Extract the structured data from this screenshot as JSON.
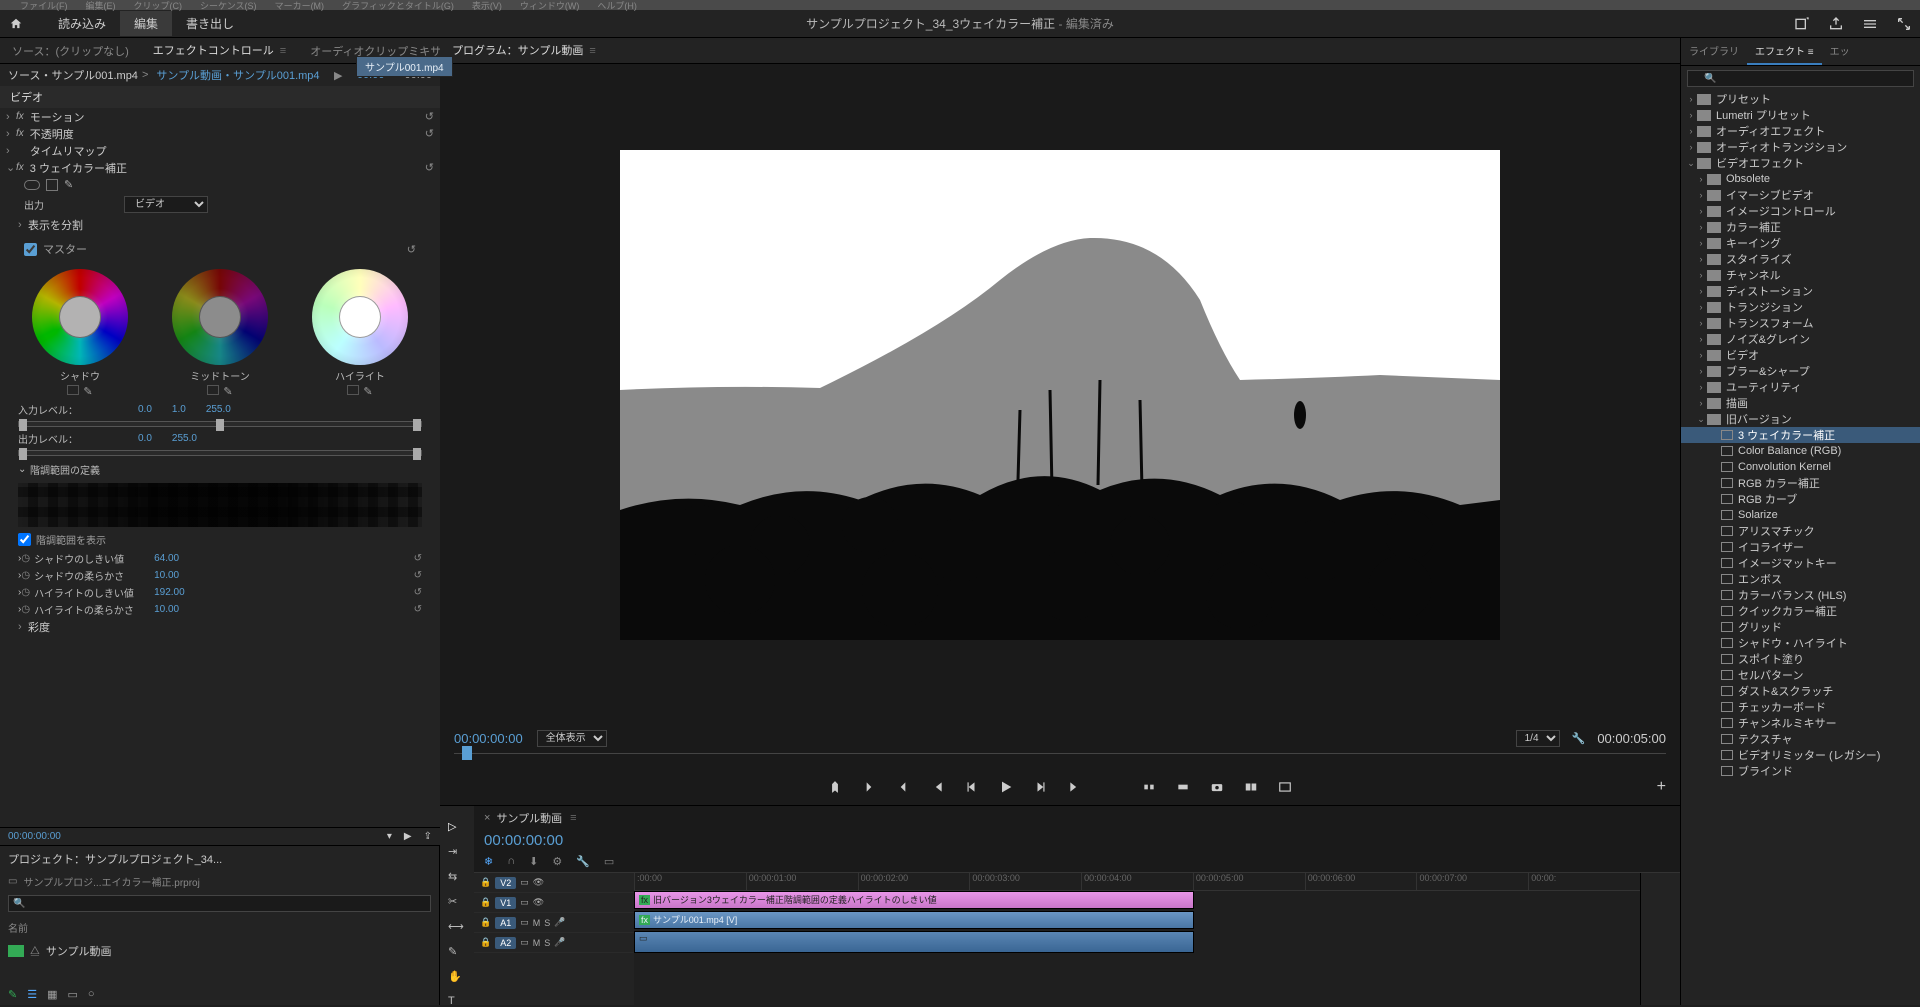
{
  "titlebar_menus": [
    "ファイル(F)",
    "編集(E)",
    "クリップ(C)",
    "シーケンス(S)",
    "マーカー(M)",
    "グラフィックとタイトル(G)",
    "表示(V)",
    "ウィンドウ(W)",
    "ヘルプ(H)"
  ],
  "workspace_tabs": {
    "import": "読み込み",
    "edit": "編集",
    "export": "書き出し"
  },
  "project_title": "サンプルプロジェクト_34_3ウェイカラー補正",
  "project_unsaved": " - 編集済み",
  "source_tabs": {
    "source": "ソース：(クリップなし)",
    "effect": "エフェクトコントロール",
    "audio_mixer": "オーディオクリップミキサー：サンプル動画"
  },
  "source_line": {
    "src": "ソース・サンプル001.mp4",
    "link": "サンプル動画・サンプル001.mp4",
    "tc1": "00:00",
    "tc2": "00:00"
  },
  "source_clip_tab": "サンプル001.mp4",
  "effect_section": "ビデオ",
  "fx": {
    "motion": "モーション",
    "opacity": "不透明度",
    "timeremap": "タイムリマップ",
    "threeway": "3 ウェイカラー補正"
  },
  "threeway": {
    "output_label": "出力",
    "output_value": "ビデオ",
    "split_label": "表示を分割",
    "master": "マスター",
    "wheels": {
      "shadow": "シャドウ",
      "midtone": "ミッドトーン",
      "highlight": "ハイライト"
    },
    "in_level": "入力レベル：",
    "in_vals": [
      "0.0",
      "1.0",
      "255.0"
    ],
    "out_level": "出力レベル：",
    "out_vals": [
      "0.0",
      "255.0"
    ],
    "tonal_def": "階調範囲の定義",
    "show_tonal": "階調範囲を表示",
    "params": [
      {
        "name": "シャドウのしきい値",
        "v": "64.00"
      },
      {
        "name": "シャドウの柔らかさ",
        "v": "10.00"
      },
      {
        "name": "ハイライトのしきい値",
        "v": "192.00"
      },
      {
        "name": "ハイライトの柔らかさ",
        "v": "10.00"
      }
    ],
    "sat": "彩度"
  },
  "effect_tc": "00:00:00:00",
  "program": {
    "tab": "プログラム：サンプル動画",
    "tc_in": "00:00:00:00",
    "fit": "全体表示",
    "scale": "1/4",
    "tc_out": "00:00:05:00"
  },
  "project_panel": {
    "title": "プロジェクト：サンプルプロジェクト_34...",
    "sub": "サンプルプロジ...エイカラー補正.prproj",
    "col": "名前",
    "item": "サンプル動画"
  },
  "timeline": {
    "seq": "サンプル動画",
    "tc": "00:00:00:00",
    "ruler": [
      ":00:00",
      "00:00:01:00",
      "00:00:02:00",
      "00:00:03:00",
      "00:00:04:00",
      "00:00:05:00",
      "00:00:06:00",
      "00:00:07:00",
      "00:00:"
    ],
    "tracks": {
      "v2": "V2",
      "v1": "V1",
      "a1": "A1",
      "a2": "A2"
    },
    "clip_fx": "旧バージョン3ウェイカラー補正階調範囲の定義ハイライトのしきい値",
    "clip_vid": "サンプル001.mp4 [V]"
  },
  "effects_panel": {
    "tabs": {
      "library": "ライブラリ",
      "effects": "エフェクト",
      "ess": "エッ"
    },
    "tree": [
      {
        "d": 0,
        "t": "folder",
        "open": false,
        "label": "プリセット"
      },
      {
        "d": 0,
        "t": "folder",
        "open": false,
        "label": "Lumetri プリセット"
      },
      {
        "d": 0,
        "t": "folder",
        "open": false,
        "label": "オーディオエフェクト"
      },
      {
        "d": 0,
        "t": "folder",
        "open": false,
        "label": "オーディオトランジション"
      },
      {
        "d": 0,
        "t": "folder",
        "open": true,
        "label": "ビデオエフェクト"
      },
      {
        "d": 1,
        "t": "folder",
        "open": false,
        "label": "Obsolete"
      },
      {
        "d": 1,
        "t": "folder",
        "open": false,
        "label": "イマーシブビデオ"
      },
      {
        "d": 1,
        "t": "folder",
        "open": false,
        "label": "イメージコントロール"
      },
      {
        "d": 1,
        "t": "folder",
        "open": false,
        "label": "カラー補正"
      },
      {
        "d": 1,
        "t": "folder",
        "open": false,
        "label": "キーイング"
      },
      {
        "d": 1,
        "t": "folder",
        "open": false,
        "label": "スタイライズ"
      },
      {
        "d": 1,
        "t": "folder",
        "open": false,
        "label": "チャンネル"
      },
      {
        "d": 1,
        "t": "folder",
        "open": false,
        "label": "ディストーション"
      },
      {
        "d": 1,
        "t": "folder",
        "open": false,
        "label": "トランジション"
      },
      {
        "d": 1,
        "t": "folder",
        "open": false,
        "label": "トランスフォーム"
      },
      {
        "d": 1,
        "t": "folder",
        "open": false,
        "label": "ノイズ&グレイン"
      },
      {
        "d": 1,
        "t": "folder",
        "open": false,
        "label": "ビデオ"
      },
      {
        "d": 1,
        "t": "folder",
        "open": false,
        "label": "ブラー&シャープ"
      },
      {
        "d": 1,
        "t": "folder",
        "open": false,
        "label": "ユーティリティ"
      },
      {
        "d": 1,
        "t": "folder",
        "open": false,
        "label": "描画"
      },
      {
        "d": 1,
        "t": "folder",
        "open": true,
        "label": "旧バージョン"
      },
      {
        "d": 2,
        "t": "fx",
        "label": "3 ウェイカラー補正",
        "sel": true
      },
      {
        "d": 2,
        "t": "fx",
        "label": "Color Balance (RGB)"
      },
      {
        "d": 2,
        "t": "fx",
        "label": "Convolution Kernel"
      },
      {
        "d": 2,
        "t": "fx",
        "label": "RGB カラー補正"
      },
      {
        "d": 2,
        "t": "fx",
        "label": "RGB カーブ"
      },
      {
        "d": 2,
        "t": "fx",
        "label": "Solarize"
      },
      {
        "d": 2,
        "t": "fx",
        "label": "アリスマチック"
      },
      {
        "d": 2,
        "t": "fx",
        "label": "イコライザー"
      },
      {
        "d": 2,
        "t": "fx",
        "label": "イメージマットキー"
      },
      {
        "d": 2,
        "t": "fx",
        "label": "エンボス"
      },
      {
        "d": 2,
        "t": "fx",
        "label": "カラーバランス (HLS)"
      },
      {
        "d": 2,
        "t": "fx",
        "label": "クイックカラー補正"
      },
      {
        "d": 2,
        "t": "fx",
        "label": "グリッド"
      },
      {
        "d": 2,
        "t": "fx",
        "label": "シャドウ・ハイライト"
      },
      {
        "d": 2,
        "t": "fx",
        "label": "スポイト塗り"
      },
      {
        "d": 2,
        "t": "fx",
        "label": "セルパターン"
      },
      {
        "d": 2,
        "t": "fx",
        "label": "ダスト&スクラッチ"
      },
      {
        "d": 2,
        "t": "fx",
        "label": "チェッカーボード"
      },
      {
        "d": 2,
        "t": "fx",
        "label": "チャンネルミキサー"
      },
      {
        "d": 2,
        "t": "fx",
        "label": "テクスチャ"
      },
      {
        "d": 2,
        "t": "fx",
        "label": "ビデオリミッター (レガシー)"
      },
      {
        "d": 2,
        "t": "fx",
        "label": "ブラインド"
      }
    ]
  }
}
